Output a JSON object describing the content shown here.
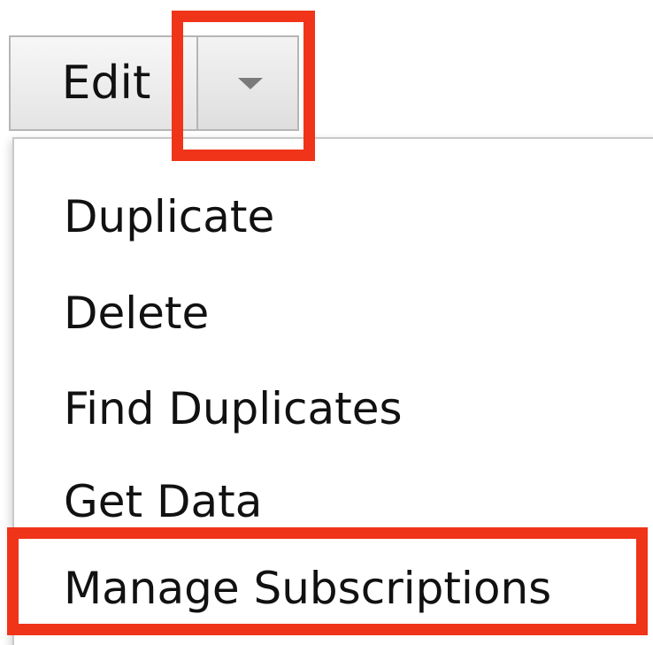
{
  "toolbar": {
    "edit_label": "Edit",
    "caret_icon": "caret-down-icon"
  },
  "menu": {
    "items": [
      {
        "label": "Duplicate"
      },
      {
        "label": "Delete"
      },
      {
        "label": "Find Duplicates"
      },
      {
        "label": "Get Data"
      },
      {
        "label": "Manage Subscriptions"
      }
    ]
  },
  "colors": {
    "highlight": "#f0341a",
    "button_border": "#b5b5b5",
    "text": "#111111"
  }
}
